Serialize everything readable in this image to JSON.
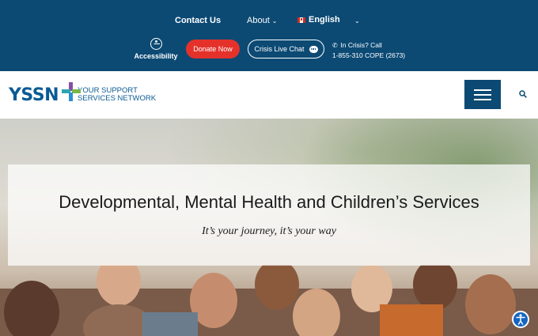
{
  "topbar": {
    "contact": "Contact Us",
    "about": "About",
    "language": "English",
    "accessibility": "Accessibility",
    "donate": "Donate Now",
    "crisis_chat": "Crisis Live Chat",
    "crisis_line1": "In Crisis? Call",
    "crisis_line2": "1-855-310 COPE (2673)"
  },
  "header": {
    "logo_mark": "YSSN",
    "logo_line1": "YOUR SUPPORT",
    "logo_line2": "SERVICES NETWORK"
  },
  "hero": {
    "title": "Developmental, Mental Health and Children’s Services",
    "subtitle": "It’s your journey, it’s your way"
  },
  "icons": [
    "accessibility-icon",
    "chat-bubble-icon",
    "phone-icon",
    "chevron-down-icon",
    "canada-flag-icon",
    "hamburger-menu-icon",
    "search-icon"
  ],
  "colors": {
    "topbar": "#0c4a74",
    "donate": "#e4322b",
    "brand_blue": "#0a5a94"
  }
}
